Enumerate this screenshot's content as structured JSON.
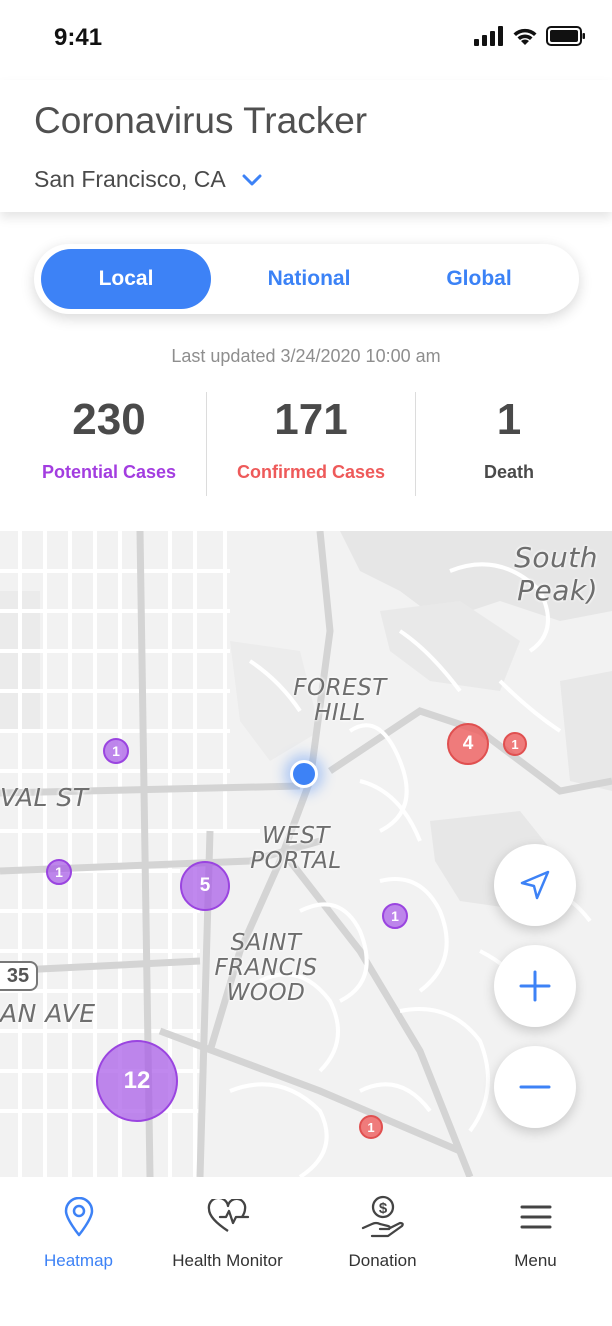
{
  "status_bar": {
    "time": "9:41"
  },
  "header": {
    "title": "Coronavirus Tracker",
    "location": "San Francisco, CA"
  },
  "segments": {
    "local": "Local",
    "national": "National",
    "global": "Global",
    "selected": "Local"
  },
  "last_updated": "Last updated 3/24/2020 10:00 am",
  "stats": {
    "potential": {
      "value": "230",
      "label": "Potential Cases",
      "color": "#a33de0"
    },
    "confirmed": {
      "value": "171",
      "label": "Confirmed Cases",
      "color": "#ee5a5a"
    },
    "death": {
      "value": "1",
      "label": "Death",
      "color": "#4a4a4a"
    }
  },
  "map": {
    "labels": {
      "south_peak": "South\nPeak)",
      "forest_hill": "FOREST\nHILL",
      "west_portal": "WEST\nPORTAL",
      "saint_francis_wood": "SAINT\nFRANCIS\nWOOD",
      "val_st": "VAL ST",
      "an_ave": "AN AVE",
      "route": "35"
    },
    "clusters": {
      "p1": "1",
      "p2": "1",
      "p3": "5",
      "p4": "1",
      "p5": "12",
      "r1": "4",
      "r2": "1",
      "r3": "1"
    }
  },
  "tabs": {
    "heatmap": "Heatmap",
    "health_monitor": "Health Monitor",
    "donation": "Donation",
    "menu": "Menu",
    "active": "Heatmap"
  },
  "colors": {
    "accent": "#3d82f6",
    "purple": "#a33de0",
    "red": "#ee5a5a"
  }
}
